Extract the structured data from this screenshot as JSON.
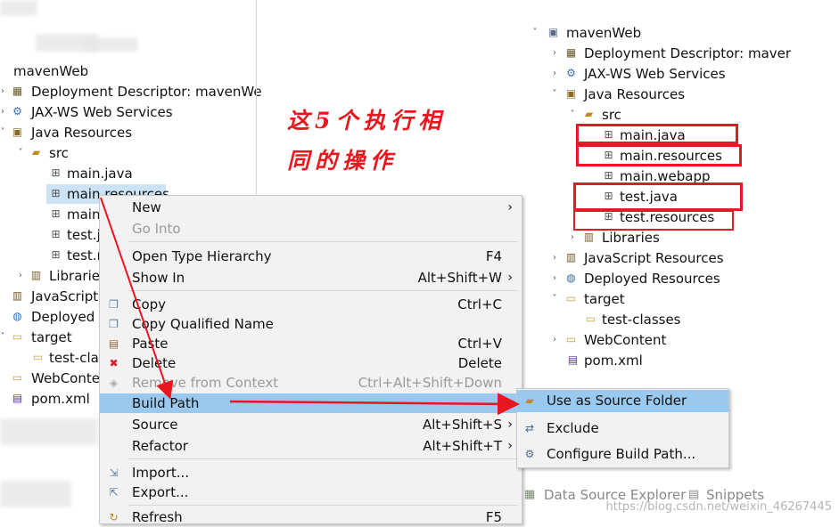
{
  "left_tree": {
    "project": "mavenWeb",
    "items": [
      {
        "label": "Deployment Descriptor: mavenWe",
        "icon": "deployment-descriptor-icon"
      },
      {
        "label": "JAX-WS Web Services",
        "icon": "web-services-icon"
      },
      {
        "label": "Java Resources",
        "icon": "java-resources-icon"
      },
      {
        "label": "src",
        "icon": "source-folder-icon"
      },
      {
        "label": "main.java",
        "icon": "package-icon"
      },
      {
        "label": "main.resources",
        "icon": "package-icon"
      },
      {
        "label": "main",
        "icon": "package-icon"
      },
      {
        "label": "test.j",
        "icon": "package-icon"
      },
      {
        "label": "test.r",
        "icon": "package-icon"
      },
      {
        "label": "Librarie",
        "icon": "library-icon"
      },
      {
        "label": "JavaScript",
        "icon": "javascript-resources-icon"
      },
      {
        "label": "Deployed",
        "icon": "deployed-resources-icon"
      },
      {
        "label": "target",
        "icon": "folder-icon"
      },
      {
        "label": "test-clas",
        "icon": "folder-icon"
      },
      {
        "label": "WebConte",
        "icon": "folder-icon"
      },
      {
        "label": "pom.xml",
        "icon": "maven-file-icon"
      }
    ]
  },
  "annotation": {
    "line1": "这5个执行相",
    "line2": "同的操作"
  },
  "context_menu": {
    "items": [
      {
        "label": "New",
        "shortcut": "",
        "submenu": true,
        "disabled": false
      },
      {
        "label": "Go Into",
        "shortcut": "",
        "submenu": false,
        "disabled": true
      },
      {
        "label": "Open Type Hierarchy",
        "shortcut": "F4",
        "submenu": false,
        "disabled": false
      },
      {
        "label": "Show In",
        "shortcut": "Alt+Shift+W",
        "submenu": true,
        "disabled": false
      },
      {
        "label": "Copy",
        "shortcut": "Ctrl+C",
        "submenu": false,
        "disabled": false,
        "icon": "copy-icon"
      },
      {
        "label": "Copy Qualified Name",
        "shortcut": "",
        "submenu": false,
        "disabled": false,
        "icon": "copy-qualified-icon"
      },
      {
        "label": "Paste",
        "shortcut": "Ctrl+V",
        "submenu": false,
        "disabled": false,
        "icon": "paste-icon"
      },
      {
        "label": "Delete",
        "shortcut": "Delete",
        "submenu": false,
        "disabled": false,
        "icon": "delete-icon"
      },
      {
        "label": "Remove from Context",
        "shortcut": "Ctrl+Alt+Shift+Down",
        "submenu": false,
        "disabled": true,
        "icon": "remove-context-icon"
      },
      {
        "label": "Build Path",
        "shortcut": "",
        "submenu": true,
        "disabled": false,
        "active": true
      },
      {
        "label": "Source",
        "shortcut": "Alt+Shift+S",
        "submenu": true,
        "disabled": false
      },
      {
        "label": "Refactor",
        "shortcut": "Alt+Shift+T",
        "submenu": true,
        "disabled": false
      },
      {
        "label": "Import...",
        "shortcut": "",
        "submenu": false,
        "disabled": false,
        "icon": "import-icon"
      },
      {
        "label": "Export...",
        "shortcut": "",
        "submenu": false,
        "disabled": false,
        "icon": "export-icon"
      },
      {
        "label": "Refresh",
        "shortcut": "F5",
        "submenu": false,
        "disabled": false,
        "icon": "refresh-icon"
      }
    ]
  },
  "build_path_submenu": {
    "items": [
      {
        "label": "Use as Source Folder",
        "icon": "source-folder-icon",
        "active": true
      },
      {
        "label": "Exclude",
        "icon": "exclude-icon"
      },
      {
        "label": "Configure Build Path...",
        "icon": "configure-icon"
      }
    ]
  },
  "right_tree": {
    "project": "mavenWeb",
    "items": [
      {
        "label": "Deployment Descriptor: maver"
      },
      {
        "label": "JAX-WS Web Services"
      },
      {
        "label": "Java Resources"
      },
      {
        "label": "src"
      },
      {
        "label": "main.java"
      },
      {
        "label": "main.resources"
      },
      {
        "label": "main.webapp"
      },
      {
        "label": "test.java"
      },
      {
        "label": "test.resources"
      },
      {
        "label": "Libraries"
      },
      {
        "label": "JavaScript Resources"
      },
      {
        "label": "Deployed Resources"
      },
      {
        "label": "target"
      },
      {
        "label": "test-classes"
      },
      {
        "label": "WebContent"
      },
      {
        "label": "pom.xml"
      }
    ]
  },
  "bottom_tabs": {
    "data_source": "Data Source Explorer",
    "snippets": "Snippets"
  },
  "watermark": "https://blog.csdn.net/weixin_46267445",
  "colors": {
    "annotation_red": "#e11a25",
    "menu_highlight": "#99c9ef",
    "selection": "#cce3f6"
  }
}
